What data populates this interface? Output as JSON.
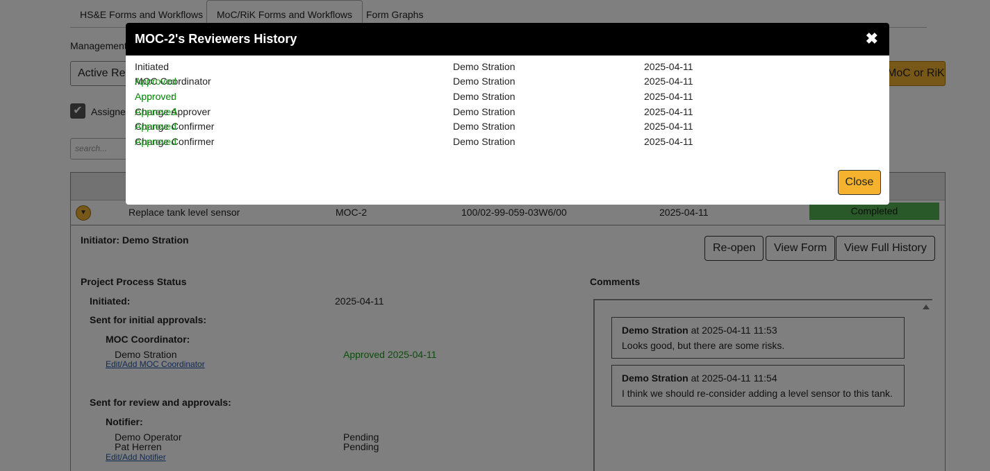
{
  "tabs": [
    {
      "label": "HS&E Forms and Workflows"
    },
    {
      "label": "MoC/RiK Forms and Workflows"
    },
    {
      "label": "Form Graphs"
    }
  ],
  "management_label": "Management",
  "active_requests_label": "Active Req",
  "moc_button_label": "MoC or RiK",
  "assigned_label": "Assigned",
  "search_placeholder": "search...",
  "record": {
    "title": "Replace tank level sensor",
    "id": "MOC-2",
    "location": "100/02-99-059-03W6/00",
    "date": "2025-04-11",
    "status": "Completed",
    "status_color": "#52b352"
  },
  "detail": {
    "initiator": "Initiator: Demo Stration",
    "buttons": {
      "reopen": "Re-open",
      "view_form": "View Form",
      "view_full_history": "View Full History"
    },
    "process_title": "Project Process Status",
    "initiated_label": "Initiated:",
    "initiated_date": "2025-04-11",
    "initial_approvals_label": "Sent for initial approvals:",
    "moc_coordinator_label": "MOC Coordinator:",
    "moc_coordinator_name": "Demo Stration",
    "moc_coordinator_status": "Approved 2025-04-11",
    "edit_moc_coordinator": "Edit/Add MOC Coordinator",
    "review_label": "Sent for review and approvals:",
    "notifier_label": "Notifier:",
    "notifiers": [
      {
        "name": "Demo Operator",
        "status": "Pending"
      },
      {
        "name": "Pat Herren",
        "status": "Pending"
      }
    ],
    "edit_notifier": "Edit/Add Notifier",
    "comments_title": "Comments",
    "comments": [
      {
        "author": "Demo Stration",
        "meta": " at 2025-04-11 11:53",
        "text": "Looks good, but there are some risks."
      },
      {
        "author": "Demo Stration",
        "meta": " at 2025-04-11 11:54",
        "text": "I think we should re-consider adding a level sensor to this tank."
      }
    ]
  },
  "modal": {
    "title": "MOC-2's Reviewers History",
    "close_label": "Close",
    "history": [
      {
        "role": "Initiated",
        "status": "",
        "user": "Demo Stration",
        "date": "2025-04-11"
      },
      {
        "role": "MOC Coordinator ",
        "status": "Approved",
        "user": "Demo Stration",
        "date": "2025-04-11"
      },
      {
        "role": "Approver ",
        "status": "Approved",
        "user": "Demo Stration",
        "date": "2025-04-11"
      },
      {
        "role": "Change Approver ",
        "status": "Approved",
        "user": "Demo Stration",
        "date": "2025-04-11"
      },
      {
        "role": "Change Confirmer ",
        "status": "Approved",
        "user": "Demo Stration",
        "date": "2025-04-11"
      },
      {
        "role": "Change Confirmer ",
        "status": "Approved",
        "user": "Demo Stration",
        "date": "2025-04-11"
      }
    ]
  },
  "colors": {
    "accent": "#f0b030",
    "approved": "#1a9a1a",
    "modal_header": "#000000"
  },
  "icons": {
    "check": "check-icon",
    "expand": "chevron-down-icon",
    "close": "close-icon",
    "scroll": "scroll-up-icon"
  }
}
